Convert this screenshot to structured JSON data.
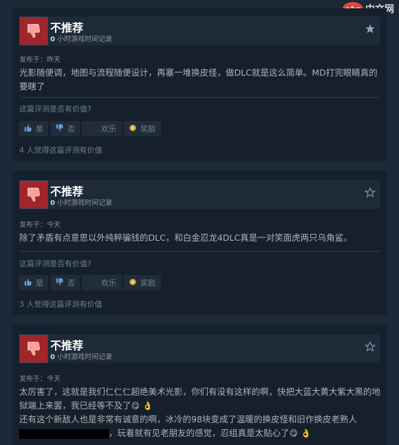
{
  "watermark": {
    "logo": "php",
    "text": "中文网"
  },
  "reviews": [
    {
      "verdict": "不推荐",
      "hours_value": "0",
      "hours_label": "小时游戏时间记录",
      "posted": "发布于：昨天",
      "body": "光影随便调，地图与流程随便设计，再塞一堆换皮怪，做DLC就是这么简单。MD打完眼睛真的要瞎了",
      "helpful_question": "这篇评测是否有价值?",
      "btn_yes": "是",
      "btn_no": "否",
      "btn_funny": "欢乐",
      "btn_award": "奖励",
      "found_helpful": "4 人觉得这篇评测有价值",
      "star_filled": true
    },
    {
      "verdict": "不推荐",
      "hours_value": "0",
      "hours_label": "小时游戏时间记录",
      "posted": "发布于：今天",
      "body": "除了矛盾有点意思以外纯粹骗钱的DLC，和白金忍龙4DLC真是一对笑面虎两只乌角鲨。",
      "helpful_question": "这篇评测是否有价值?",
      "btn_yes": "是",
      "btn_no": "否",
      "btn_funny": "欢乐",
      "btn_award": "奖励",
      "found_helpful": "3 人觉得这篇评测有价值",
      "star_filled": false
    },
    {
      "verdict": "不推荐",
      "hours_value": "0",
      "hours_label": "小时游戏时间记录",
      "posted": "发布于：今天",
      "body_line1": "太厉害了，这就是我们仁仁仁超绝美术光影，你们有没有这样的啊，快把大蓝大黄大紫大黑的地狱端上来罢，我已经等不及了",
      "body_line2": "还有这个新敌人也是非常有诚意的啊，冰冷的98块变成了温暖的换皮怪和旧作换皮老熟人",
      "body_line3": "，玩着就有见老朋友的感觉，忍组真是太贴心了",
      "star_filled": false
    }
  ]
}
